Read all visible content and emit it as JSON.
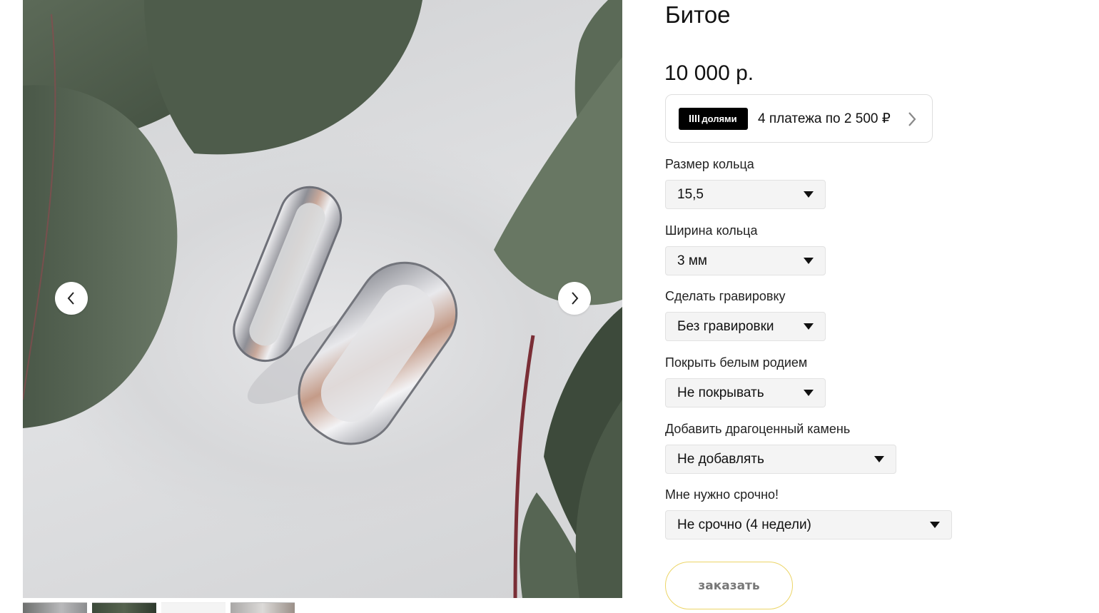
{
  "product": {
    "title": "Битое",
    "price": "10 000 р."
  },
  "dolyami": {
    "badge_label": "долями",
    "text": "4 платежа по 2 500 ₽",
    "icon": "chevron-right-icon"
  },
  "gallery": {
    "prev_icon": "chevron-left-icon",
    "next_icon": "chevron-right-icon",
    "thumbnail_count": 4
  },
  "options": [
    {
      "label": "Размер кольца",
      "value": "15,5"
    },
    {
      "label": "Ширина кольца",
      "value": "3 мм"
    },
    {
      "label": "Сделать гравировку",
      "value": "Без гравировки"
    },
    {
      "label": "Покрыть белым родием",
      "value": "Не покрывать"
    },
    {
      "label": "Добавить драгоценный камень",
      "value": "Не добавлять"
    },
    {
      "label": "Мне нужно срочно!",
      "value": "Не срочно (4 недели)"
    }
  ],
  "order_button": "заказать",
  "colors": {
    "order_border": "#ecd567",
    "select_bg": "#f4f4f4",
    "badge_bg": "#000000"
  }
}
